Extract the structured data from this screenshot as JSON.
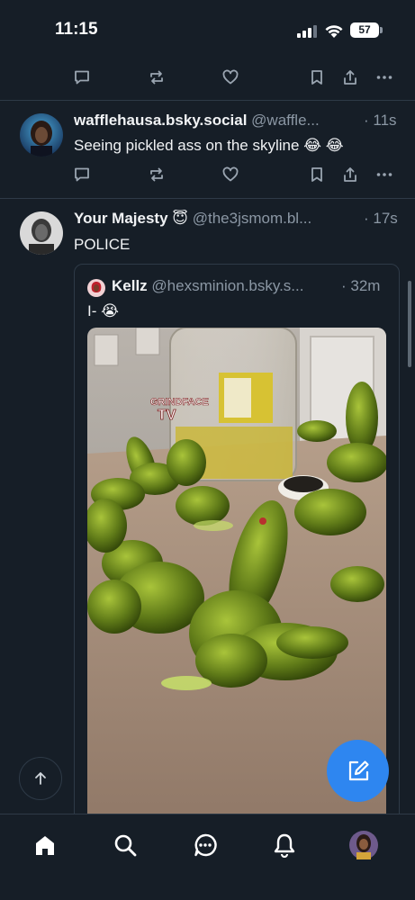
{
  "status_bar": {
    "time": "11:15",
    "battery": "57"
  },
  "posts": [
    {
      "author": "wafflehausa.bsky.social",
      "handle": "@waffle...",
      "time": "· 11s",
      "text": "Seeing pickled ass on the skyline 😂 😂"
    },
    {
      "author": "Your Majesty 😇",
      "handle": "@the3jsmom.bl...",
      "time": "· 17s",
      "text": "POLICE",
      "quote": {
        "author": "Kellz",
        "handle": "@hexsminion.bsky.s...",
        "time": "· 32m",
        "text": "I- 😭",
        "image_watermark": "GRINDFACE TV"
      }
    }
  ],
  "icons": {
    "reply": "reply-icon",
    "repost": "repost-icon",
    "like": "heart-icon",
    "bookmark": "bookmark-icon",
    "share": "share-icon",
    "more": "more-icon"
  },
  "tabs": [
    "home",
    "search",
    "chat",
    "notifications",
    "profile"
  ],
  "colors": {
    "background": "#161e27",
    "accent": "#2e86f0",
    "muted": "#8b97a4",
    "divider": "#2e3a47"
  }
}
